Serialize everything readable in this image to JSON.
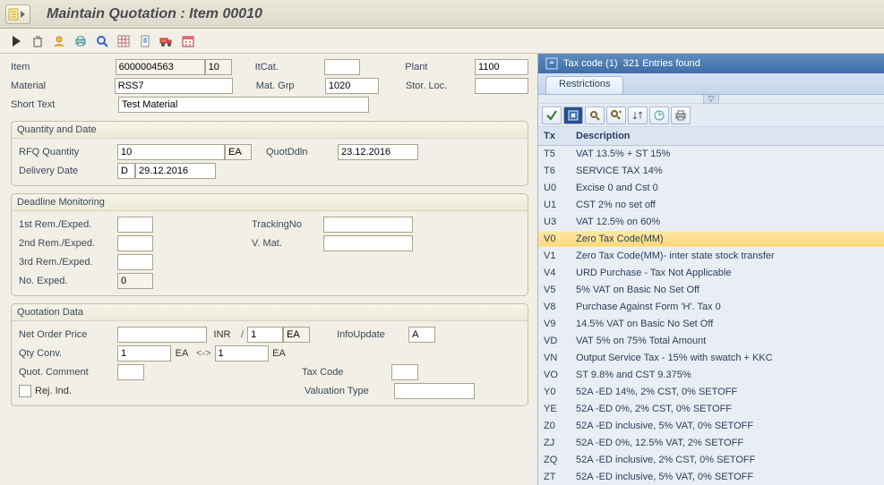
{
  "title": "Maintain Quotation : Item 00010",
  "header": {
    "item_label": "Item",
    "item_no": "6000004563",
    "item_line": "10",
    "itcat_label": "ItCat.",
    "itcat": "",
    "plant_label": "Plant",
    "plant": "1100",
    "material_label": "Material",
    "material": "RSS7",
    "matgrp_label": "Mat. Grp",
    "matgrp": "1020",
    "storloc_label": "Stor. Loc.",
    "storloc": "",
    "shorttext_label": "Short Text",
    "shorttext": "Test Material"
  },
  "qty": {
    "group": "Quantity and Date",
    "rfq_label": "RFQ Quantity",
    "rfq": "10",
    "rfq_uom": "EA",
    "quotddln_label": "QuotDdln",
    "quotddln": "23.12.2016",
    "deliv_label": "Delivery Date",
    "deliv_cat": "D",
    "deliv": "29.12.2016"
  },
  "deadline": {
    "group": "Deadline Monitoring",
    "r1": "1st Rem./Exped.",
    "r2": "2nd Rem./Exped.",
    "r3": "3rd Rem./Exped.",
    "track_label": "TrackingNo",
    "vmat_label": "V. Mat.",
    "noexp_label": "No. Exped.",
    "noexp": "0"
  },
  "quot": {
    "group": "Quotation Data",
    "netpr_label": "Net Order Price",
    "netpr": "",
    "curr": "INR",
    "per": "/",
    "per_qty": "1",
    "per_uom": "EA",
    "infoupd_label": "InfoUpdate",
    "infoupd": "A",
    "qtyconv_label": "Qty Conv.",
    "conv_from": "1",
    "conv_from_uom": "EA",
    "conv_arrow": "<->",
    "conv_to": "1",
    "conv_to_uom": "EA",
    "comment_label": "Quot. Comment",
    "taxcode_label": "Tax Code",
    "rej_label": "Rej. Ind.",
    "valtype_label": "Valuation Type"
  },
  "searchhelp": {
    "title_field": "Tax code (1)",
    "title_count": "321 Entries found",
    "tab": "Restrictions",
    "col_tx": "Tx",
    "col_desc": "Description",
    "selected": "V0",
    "rows": [
      {
        "tx": "T5",
        "desc": "VAT 13.5% + ST 15%"
      },
      {
        "tx": "T6",
        "desc": "SERVICE TAX 14%"
      },
      {
        "tx": "U0",
        "desc": "Excise 0 and Cst 0"
      },
      {
        "tx": "U1",
        "desc": "CST 2% no set off"
      },
      {
        "tx": "U3",
        "desc": "VAT 12.5% on 60%"
      },
      {
        "tx": "V0",
        "desc": "Zero Tax Code(MM)"
      },
      {
        "tx": "V1",
        "desc": "Zero Tax Code(MM)- inter state stock transfer"
      },
      {
        "tx": "V4",
        "desc": "URD Purchase - Tax Not Applicable"
      },
      {
        "tx": "V5",
        "desc": "5% VAT on Basic No Set Off"
      },
      {
        "tx": "V8",
        "desc": "Purchase Against Form 'H'. Tax 0"
      },
      {
        "tx": "V9",
        "desc": "14.5% VAT on Basic  No Set Off"
      },
      {
        "tx": "VD",
        "desc": "VAT 5% on 75% Total Amount"
      },
      {
        "tx": "VN",
        "desc": "Output Service Tax - 15% with swatch + KKC"
      },
      {
        "tx": "VO",
        "desc": "ST 9.8% and CST 9.375%"
      },
      {
        "tx": "Y0",
        "desc": "52A -ED 14%, 2% CST, 0% SETOFF"
      },
      {
        "tx": "YE",
        "desc": "52A -ED 0%, 2% CST, 0% SETOFF"
      },
      {
        "tx": "Z0",
        "desc": "52A -ED inclusive, 5% VAT, 0% SETOFF"
      },
      {
        "tx": "ZJ",
        "desc": "52A -ED 0%, 12.5% VAT, 2% SETOFF"
      },
      {
        "tx": "ZQ",
        "desc": "52A -ED inclusive, 2% CST, 0% SETOFF"
      },
      {
        "tx": "ZT",
        "desc": "52A -ED inclusive, 5% VAT, 0% SETOFF"
      }
    ]
  }
}
